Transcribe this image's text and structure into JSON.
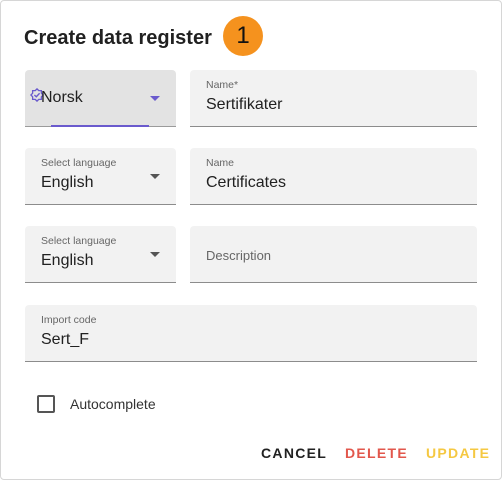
{
  "dialog": {
    "title": "Create data register",
    "badge": "1"
  },
  "fields": {
    "language_main": {
      "value": "Norsk"
    },
    "name_main": {
      "label": "Name*",
      "value": "Sertifikater"
    },
    "language_en": {
      "label": "Select language",
      "value": "English"
    },
    "name_en": {
      "label": "Name",
      "value": "Certificates"
    },
    "language_desc": {
      "label": "Select language",
      "value": "English"
    },
    "description": {
      "placeholder": "Description"
    },
    "import_code": {
      "label": "Import code",
      "value": "Sert_F"
    }
  },
  "autocomplete": {
    "label": "Autocomplete",
    "checked": false
  },
  "actions": {
    "cancel": "CANCEL",
    "delete": "DELETE",
    "update": "UPDATE"
  },
  "colors": {
    "badge": "#f5921e",
    "accent": "#6a5acd",
    "cancel": "#212121",
    "delete": "#e2574c",
    "update": "#f5c842"
  }
}
